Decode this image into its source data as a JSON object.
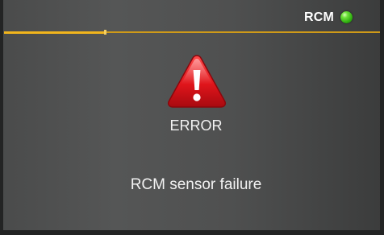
{
  "status_bar": {
    "label": "RCM",
    "indicator_icon": "status-led-icon",
    "indicator_color": "#3cc21a",
    "accent_color": "#f2b51c",
    "progress_fraction": 0.27
  },
  "alert": {
    "icon": "warning-triangle-icon",
    "icon_color": "#e0151b",
    "title": "ERROR",
    "message": "RCM sensor failure"
  }
}
